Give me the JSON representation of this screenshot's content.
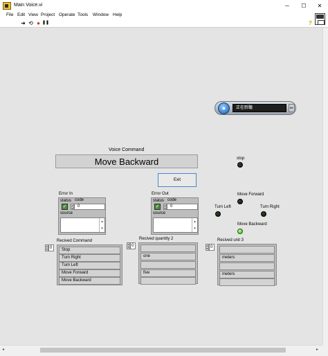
{
  "window": {
    "title": "Main Voice.vi",
    "minimize": "─",
    "maximize": "☐",
    "close": "✕"
  },
  "menu": [
    "File",
    "Edit",
    "View",
    "Project",
    "Operate",
    "Tools",
    "Window",
    "Help"
  ],
  "toolbar": {
    "run": "➜",
    "run_continuous": "⟲",
    "abort": "●",
    "pause": "❚❚",
    "help": "?"
  },
  "speech_widget": {
    "status_text": "正在聆聽",
    "mic_glyph": "●",
    "end_glyph": "▸▸"
  },
  "voice_command": {
    "label": "Voice Command",
    "value": "Move Backward"
  },
  "exit_button": {
    "label": "Exit"
  },
  "leds": {
    "stop": {
      "label": "stop",
      "on": false
    },
    "move_forward": {
      "label": "Move Forward",
      "on": false
    },
    "turn_left": {
      "label": "Turn Left",
      "on": false
    },
    "turn_right": {
      "label": "Turn Right",
      "on": false
    },
    "move_backward": {
      "label": "Move Backward",
      "on": true
    }
  },
  "error_in": {
    "label": "Error In",
    "status_label": "status",
    "code_label": "code",
    "code_value": "0",
    "source_label": "source",
    "check": "✓"
  },
  "error_out": {
    "label": "Error Out",
    "status_label": "status",
    "code_label": "code",
    "code_value": "0",
    "source_label": "source",
    "check": "✓"
  },
  "recived_command": {
    "label": "Recived Command",
    "index": "0",
    "items": [
      "Stop",
      "Turn Right",
      "Turn Left",
      "Move Forward",
      "Move Backward"
    ]
  },
  "recived_quantity": {
    "label": "Recived quantity 2",
    "index": "0",
    "items": [
      "",
      "one",
      "",
      "five",
      ""
    ]
  },
  "recived_unit": {
    "label": "Recived unit 3",
    "index": "0",
    "items": [
      "",
      "meters",
      "",
      "meters",
      ""
    ]
  },
  "scrollbar": {
    "left_arrow": "◂",
    "right_arrow": "▸"
  }
}
